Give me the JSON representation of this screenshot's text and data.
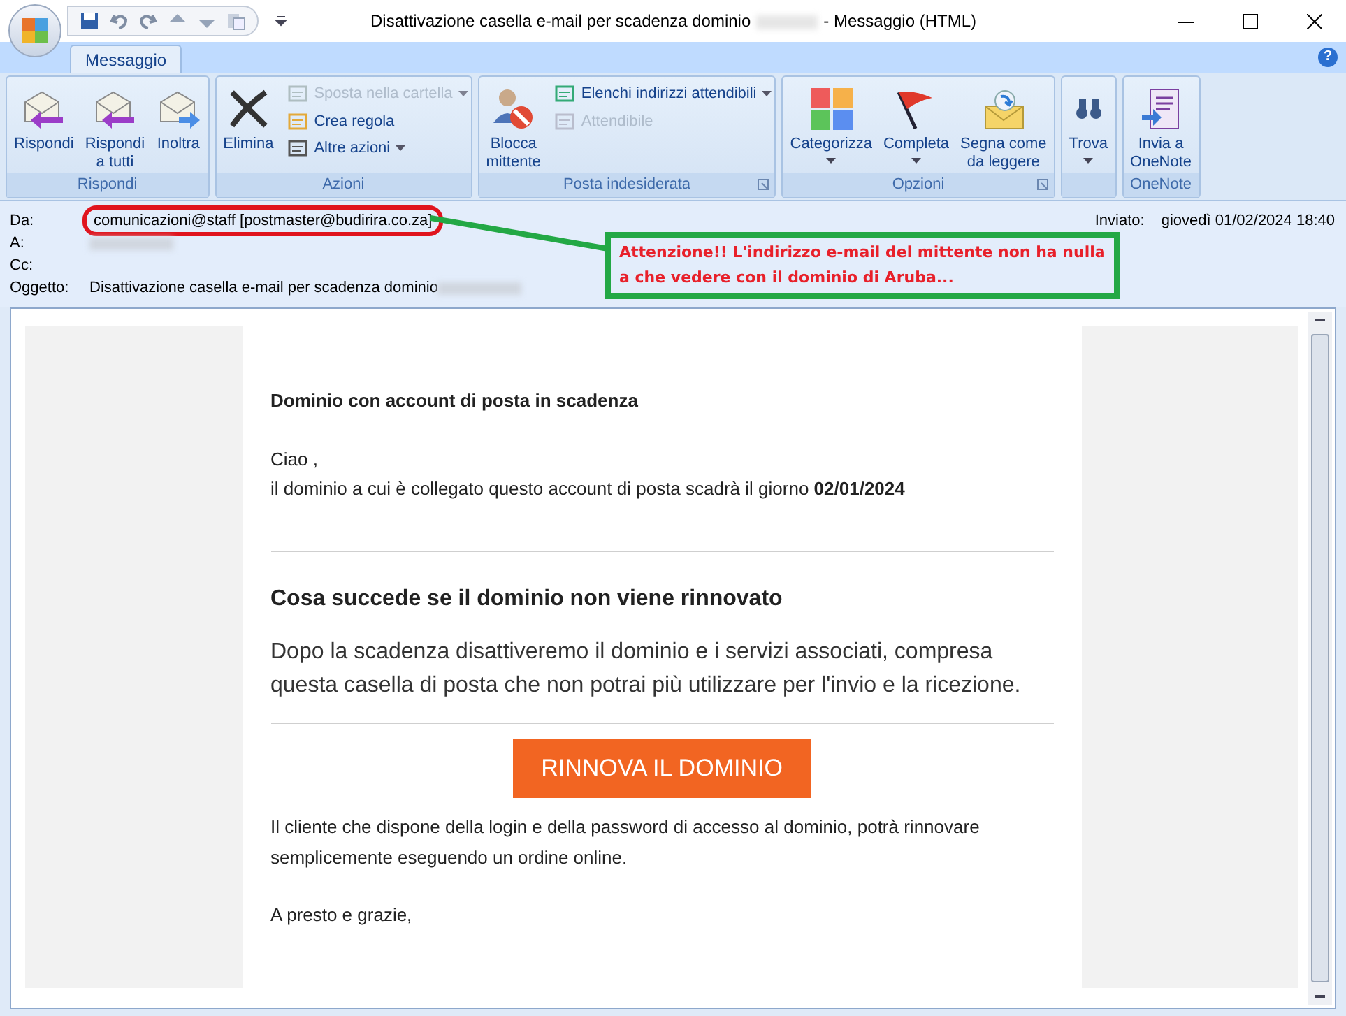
{
  "window": {
    "title": "Disattivazione casella e-mail per scadenza dominio",
    "title_suffix": "- Messaggio (HTML)"
  },
  "tabs": [
    {
      "label": "Messaggio",
      "selected": true
    }
  ],
  "help": "?",
  "ribbon": {
    "groups": [
      {
        "label": "Rispondi",
        "launcher": false,
        "buttons": [
          {
            "kind": "large",
            "label": "Rispondi",
            "disabled": false,
            "dropdown": false
          },
          {
            "kind": "large",
            "label": "Rispondi\na tutti",
            "disabled": false,
            "dropdown": false
          },
          {
            "kind": "large",
            "label": "Inoltra",
            "disabled": false,
            "dropdown": false
          }
        ]
      },
      {
        "label": "Azioni",
        "launcher": false,
        "buttons": [
          {
            "kind": "large",
            "label": "Elimina",
            "disabled": false,
            "dropdown": false
          },
          {
            "kind": "small",
            "label": "Sposta nella cartella",
            "disabled": true,
            "dropdown": true
          },
          {
            "kind": "small",
            "label": "Crea regola",
            "disabled": false,
            "dropdown": false
          },
          {
            "kind": "small",
            "label": "Altre azioni",
            "disabled": false,
            "dropdown": true
          }
        ]
      },
      {
        "label": "Posta indesiderata",
        "launcher": true,
        "buttons": [
          {
            "kind": "large",
            "label": "Blocca\nmittente",
            "disabled": false,
            "dropdown": false
          },
          {
            "kind": "small",
            "label": "Elenchi indirizzi attendibili",
            "disabled": false,
            "dropdown": true
          },
          {
            "kind": "small",
            "label": "Attendibile",
            "disabled": true,
            "dropdown": false
          }
        ]
      },
      {
        "label": "Opzioni",
        "launcher": true,
        "buttons": [
          {
            "kind": "large",
            "label": "Categorizza",
            "disabled": false,
            "dropdown": true
          },
          {
            "kind": "large",
            "label": "Completa",
            "disabled": false,
            "dropdown": true
          },
          {
            "kind": "large",
            "label": "Segna come\nda leggere",
            "disabled": false,
            "dropdown": false
          }
        ]
      },
      {
        "launcher": false,
        "buttons": [
          {
            "kind": "large",
            "label": "Trova",
            "disabled": false,
            "dropdown": true
          }
        ]
      },
      {
        "label": "OneNote",
        "launcher": false,
        "buttons": [
          {
            "kind": "large",
            "label": "Invia a\nOneNote",
            "disabled": false,
            "dropdown": false
          }
        ]
      }
    ]
  },
  "header": {
    "sender": {
      "label": "Da:",
      "value": "comunicazioni@staff [postmaster@budirira.co.za]",
      "circled": true
    },
    "fields": [
      {
        "label": "A:",
        "redacted": true
      },
      {
        "label": "Cc:",
        "redacted": false
      },
      {
        "label": "Oggetto:",
        "value": "Disattivazione casella e-mail per scadenza dominio",
        "redacted": true
      }
    ],
    "sent_label": "Inviato:",
    "sent_value": "giovedì 01/02/2024 18:40"
  },
  "annotation": {
    "text": "Attenzione!! L'indirizzo e-mail del mittente non ha nulla a che vedere con il dominio di Aruba..."
  },
  "email": {
    "heading": "Dominio con account di posta in scadenza",
    "greeting": "Ciao ,",
    "line": "il dominio a cui è collegato questo account di posta scadrà il giorno **02/01/2024**",
    "section_title": "Cosa succede se il dominio non viene rinnovato",
    "section_text": "Dopo la scadenza disattiveremo il dominio e i servizi associati, compresa questa casella di posta che non potrai più utilizzare per l'invio e la ricezione.",
    "button": "RINNOVA IL DOMINIO",
    "paragraph": "Il cliente che dispone della login e della password di accesso al dominio, potrà rinnovare semplicemente eseguendo un ordine online.",
    "closing": "A presto e grazie,"
  }
}
